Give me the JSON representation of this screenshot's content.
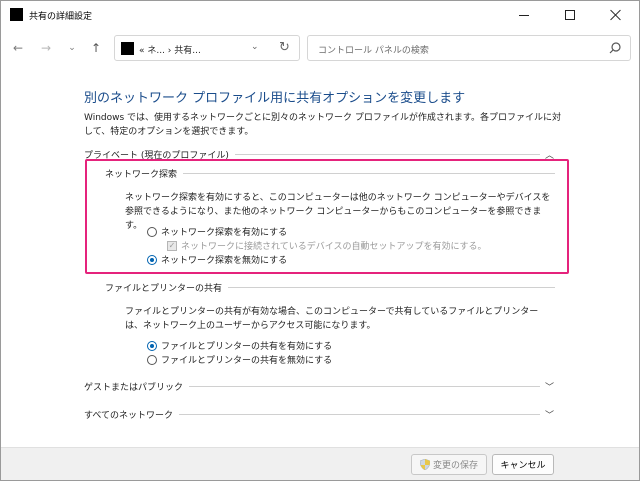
{
  "window": {
    "title": "共有の詳細設定",
    "controls": {
      "minimize": "minimize-icon",
      "maximize": "maximize-icon",
      "close": "close-icon"
    }
  },
  "nav": {
    "address": "«  ネ...  ›  共有...",
    "search_placeholder": "コントロール パネルの検索"
  },
  "content": {
    "heading": "別のネットワーク プロファイル用に共有オプションを変更します",
    "intro": "Windows では、使用するネットワークごとに別々のネットワーク プロファイルが作成されます。各プロファイルに対して、特定のオプションを選択できます。",
    "private_section": {
      "label": "プライベート (現在のプロファイル)",
      "network_discovery": {
        "label": "ネットワーク探索",
        "description": "ネットワーク探索を有効にすると、このコンピューターは他のネットワーク コンピューターやデバイスを参照できるようになり、また他のネットワーク コンピューターからもこのコンピューターを参照できます。",
        "option_on": "ネットワーク探索を有効にする",
        "auto_setup": "ネットワークに接続されているデバイスの自動セットアップを有効にする。",
        "option_off": "ネットワーク探索を無効にする",
        "selected": "off"
      },
      "file_printer_sharing": {
        "label": "ファイルとプリンターの共有",
        "description": "ファイルとプリンターの共有が有効な場合、このコンピューターで共有しているファイルとプリンターは、ネットワーク上のユーザーからアクセス可能になります。",
        "option_on": "ファイルとプリンターの共有を有効にする",
        "option_off": "ファイルとプリンターの共有を無効にする",
        "selected": "on"
      }
    },
    "guest_section": {
      "label": "ゲストまたはパブリック"
    },
    "all_networks_section": {
      "label": "すべてのネットワーク"
    }
  },
  "footer": {
    "save_label": "変更の保存",
    "cancel_label": "キャンセル"
  },
  "colors": {
    "heading": "#1a4c8b",
    "highlight": "#e5237c",
    "radio_accent": "#0063b1"
  }
}
